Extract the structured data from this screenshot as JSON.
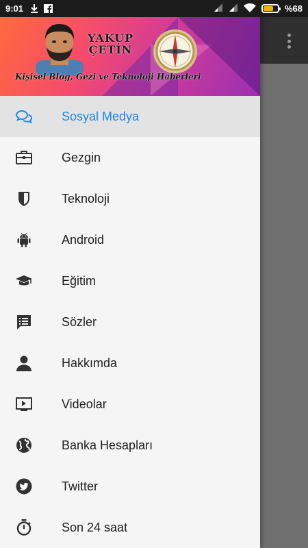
{
  "status_bar": {
    "time": "9:01",
    "battery_text": "%68",
    "battery_level": 0.68,
    "icons": [
      "download-icon",
      "facebook-icon",
      "signal-icon",
      "signal-icon",
      "wifi-icon",
      "battery-icon"
    ]
  },
  "app_bar": {
    "overflow_icon": "more-vert-icon"
  },
  "drawer": {
    "header": {
      "name_line1": "YAKUP",
      "name_line2": "ÇETİN",
      "tagline": "Kişisel Blog, Gezi ve Teknoloji Haberleri"
    },
    "accent_color": "#1e88e5",
    "items": [
      {
        "label": "Sosyal Medya",
        "icon": "chat-bubbles-icon",
        "active": true
      },
      {
        "label": "Gezgin",
        "icon": "briefcase-icon",
        "active": false
      },
      {
        "label": "Teknoloji",
        "icon": "shield-icon",
        "active": false
      },
      {
        "label": "Android",
        "icon": "android-icon",
        "active": false
      },
      {
        "label": "Eğitim",
        "icon": "graduation-cap-icon",
        "active": false
      },
      {
        "label": "Sözler",
        "icon": "quote-list-icon",
        "active": false
      },
      {
        "label": "Hakkımda",
        "icon": "person-icon",
        "active": false
      },
      {
        "label": "Videolar",
        "icon": "video-play-icon",
        "active": false
      },
      {
        "label": "Banka Hesapları",
        "icon": "globe-icon",
        "active": false
      },
      {
        "label": "Twitter",
        "icon": "twitter-icon",
        "active": false
      },
      {
        "label": "Son 24 saat",
        "icon": "stopwatch-icon",
        "active": false
      }
    ]
  }
}
